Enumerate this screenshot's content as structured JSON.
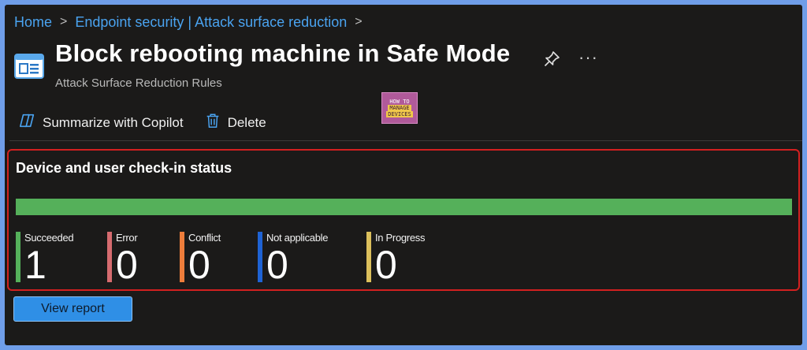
{
  "breadcrumb": {
    "items": [
      "Home",
      "Endpoint security | Attack surface reduction"
    ],
    "separator": ">"
  },
  "header": {
    "title": "Block rebooting machine in Safe Mode",
    "subtitle": "Attack Surface Reduction Rules",
    "more_label": "···",
    "blade_icon": "policy-blade-icon",
    "pin_icon": "pin-icon"
  },
  "logo": {
    "line1": "HOW TO",
    "line2": "MANAGE",
    "line3": "DEVICES"
  },
  "toolbar": {
    "summarize_label": "Summarize with Copilot",
    "summarize_icon": "copilot-icon",
    "delete_label": "Delete",
    "delete_icon": "trash-icon"
  },
  "status_card": {
    "title": "Device and user check-in status",
    "progress_succeeded_fraction": 1.0,
    "stats": [
      {
        "label": "Succeeded",
        "count": "1",
        "color": "#55b05a"
      },
      {
        "label": "Error",
        "count": "0",
        "color": "#d66b6f"
      },
      {
        "label": "Conflict",
        "count": "0",
        "color": "#ee7d3b"
      },
      {
        "label": "Not applicable",
        "count": "0",
        "color": "#1f63d4"
      },
      {
        "label": "In Progress",
        "count": "0",
        "color": "#dcc05c"
      }
    ]
  },
  "actions": {
    "view_report_label": "View report"
  },
  "colors": {
    "accent": "#4aa3f0",
    "highlight_border": "#d32020",
    "button": "#2f8fe6"
  }
}
